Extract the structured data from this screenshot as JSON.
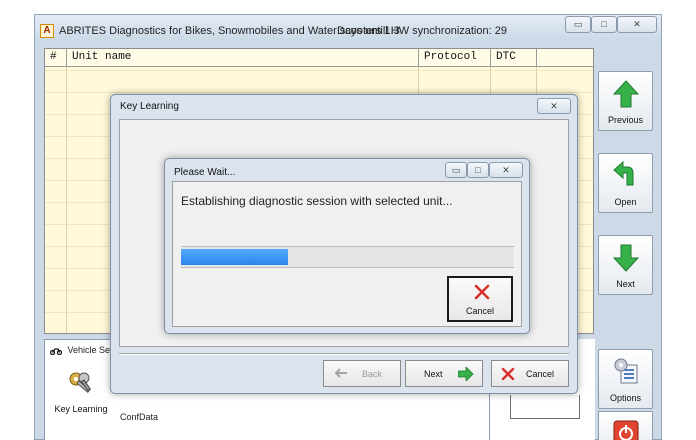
{
  "window": {
    "app_icon": "A",
    "title": "ABRITES Diagnostics for Bikes, Snowmobiles and Water scooters 1.3",
    "sync_text": "Days untill HW synchronization: 29"
  },
  "table": {
    "columns": [
      "#",
      "Unit name",
      "Protocol",
      "DTC"
    ],
    "rows": []
  },
  "side_buttons": {
    "previous": "Previous",
    "open": "Open",
    "next": "Next",
    "options": "Options"
  },
  "vehicle_panel": {
    "tab_label": "Vehicle Selec",
    "items": [
      {
        "label": "Key Learning"
      }
    ],
    "confdata": "ConfData"
  },
  "key_learning_dialog": {
    "title": "Key Learning",
    "back_label": "Back",
    "next_label": "Next",
    "cancel_label": "Cancel"
  },
  "please_wait_dialog": {
    "title": "Please Wait...",
    "message": "Establishing diagnostic session with selected unit...",
    "progress": 0.32,
    "cancel_label": "Cancel"
  },
  "colors": {
    "table_bg": "#fff9d9",
    "progress": "#2b86ec",
    "arrow_green": "#37b24a",
    "cancel_red": "#d9302c"
  }
}
